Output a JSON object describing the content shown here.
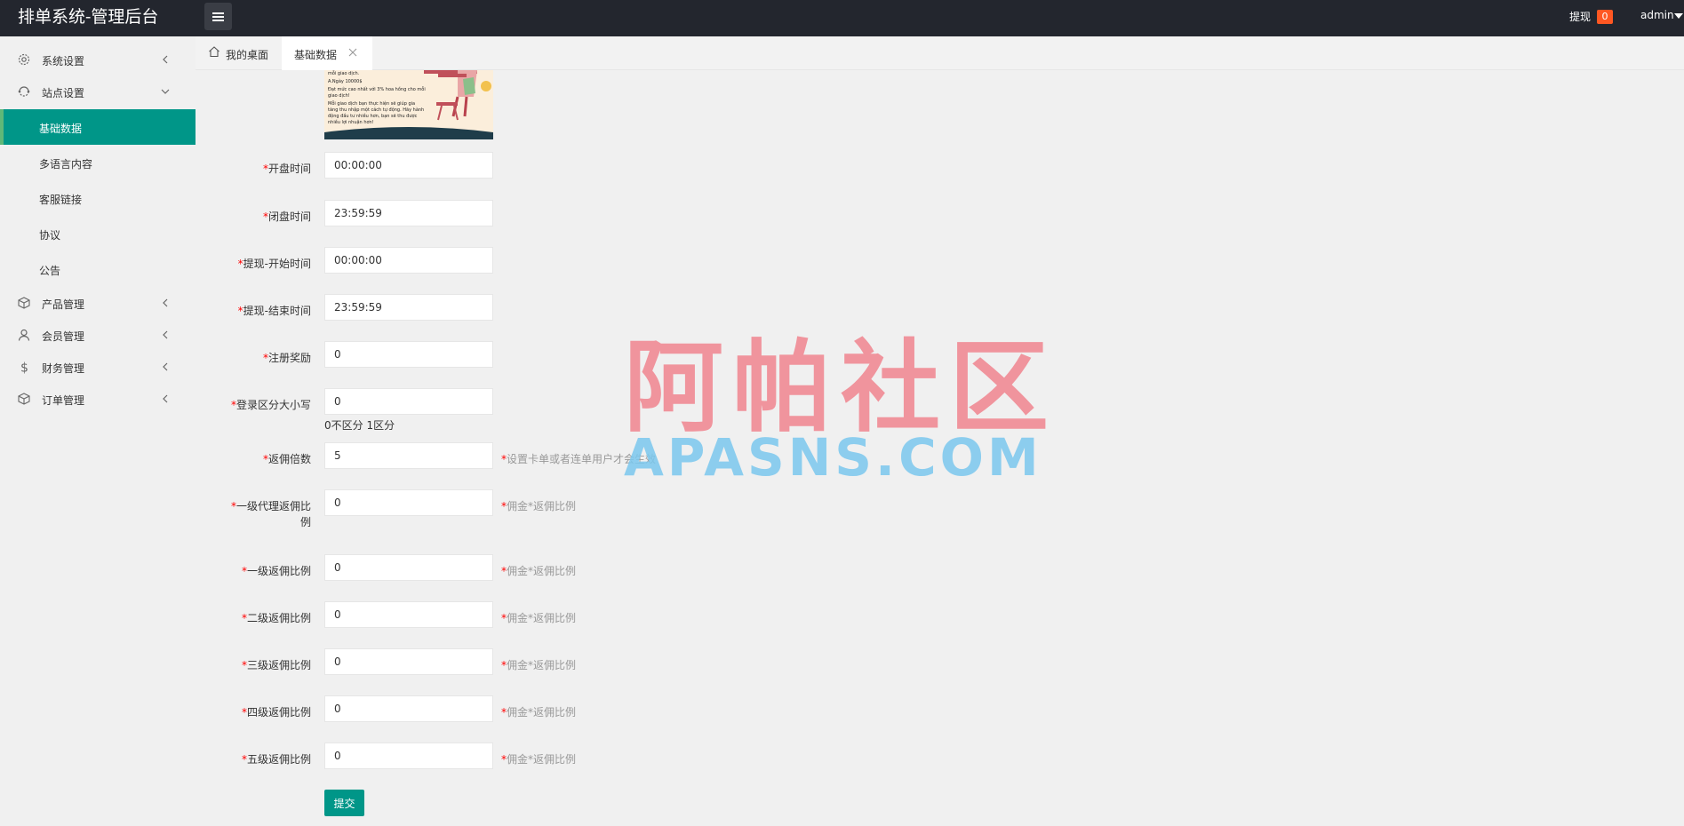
{
  "header": {
    "app_title": "排单系统-管理后台",
    "withdraw_label": "提现",
    "withdraw_badge": "0",
    "user": "admin"
  },
  "sidebar": {
    "items": [
      {
        "label": "系统设置",
        "icon": "gear-icon"
      },
      {
        "label": "站点设置",
        "icon": "site-icon"
      },
      {
        "label": "产品管理",
        "icon": "box-icon"
      },
      {
        "label": "会员管理",
        "icon": "user-icon"
      },
      {
        "label": "财务管理",
        "icon": "dollar-icon"
      },
      {
        "label": "订单管理",
        "icon": "box-icon"
      }
    ],
    "sub_items": [
      "基础数据",
      "多语言内容",
      "客服链接",
      "协议",
      "公告"
    ]
  },
  "tabs": {
    "home": "我的桌面",
    "current": "基础数据"
  },
  "banner": {
    "lines": [
      "mỗi giao dịch.",
      "A.Ngày 10000$",
      "Đạt mức cao nhất với 3% hoa hồng cho mỗi giao dịch!",
      "Mỗi giao dịch bạn thực hiện sẽ giúp gia tăng thu nhập một cách tự động. Hãy hành động đầu tư nhiều hơn, bạn sẽ thu được nhiều lợi nhuận hơn!"
    ]
  },
  "form": {
    "open_time": {
      "label": "开盘时间",
      "value": "00:00:00"
    },
    "close_time": {
      "label": "闭盘时间",
      "value": "23:59:59"
    },
    "withdraw_start": {
      "label": "提现-开始时间",
      "value": "00:00:00"
    },
    "withdraw_end": {
      "label": "提现-结束时间",
      "value": "23:59:59"
    },
    "register_reward": {
      "label": "注册奖励",
      "value": "0"
    },
    "login_case": {
      "label": "登录区分大小写",
      "value": "0",
      "note": "0不区分 1区分"
    },
    "commission_multiple": {
      "label": "返佣倍数",
      "value": "5",
      "hint": "设置卡单或者连单用户才会生效"
    },
    "agent_level1_ratio": {
      "label_line1": "一级代理返佣比",
      "label_line2": "例",
      "value": "0",
      "hint": "佣金*返佣比例"
    },
    "level1_ratio": {
      "label": "一级返佣比例",
      "value": "0",
      "hint": "佣金*返佣比例"
    },
    "level2_ratio": {
      "label": "二级返佣比例",
      "value": "0",
      "hint": "佣金*返佣比例"
    },
    "level3_ratio": {
      "label": "三级返佣比例",
      "value": "0",
      "hint": "佣金*返佣比例"
    },
    "level4_ratio": {
      "label": "四级返佣比例",
      "value": "0",
      "hint": "佣金*返佣比例"
    },
    "level5_ratio": {
      "label": "五级返佣比例",
      "value": "0",
      "hint": "佣金*返佣比例"
    },
    "required_mark": "*",
    "submit_label": "提交"
  },
  "watermark": {
    "cn": "阿帕社区",
    "en": "APASNS.COM"
  },
  "colors": {
    "header_bg": "#23262e",
    "accent": "#009688",
    "badge": "#ff5722",
    "required": "#ff0000"
  }
}
